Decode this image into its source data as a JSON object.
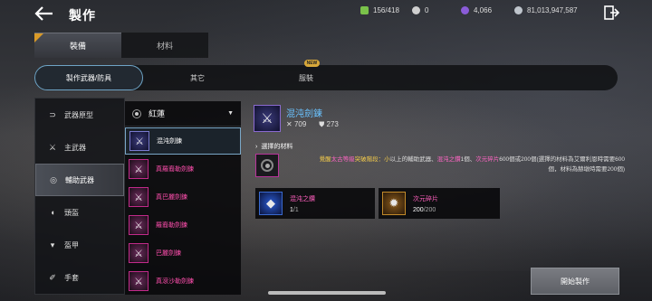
{
  "header": {
    "title": "製作",
    "currencies": [
      {
        "name": "inventory",
        "value": "156/418",
        "color": "#7ac24a"
      },
      {
        "name": "silver",
        "value": "0",
        "color": "#cfcfcf"
      },
      {
        "name": "crystal",
        "value": "4,066",
        "color": "#8a5cd8"
      },
      {
        "name": "gold",
        "value": "81,013,947,587",
        "color": "#bfc5cc"
      }
    ]
  },
  "main_tabs": [
    {
      "label": "裝備"
    },
    {
      "label": "材料"
    }
  ],
  "sub_tabs": [
    {
      "label": "製作武器/防具"
    },
    {
      "label": "其它"
    },
    {
      "label": "服裝",
      "badge": "NEW"
    }
  ],
  "categories": [
    {
      "label": "武器原型",
      "icon": "return-icon"
    },
    {
      "label": "主武器",
      "icon": "crossed-swords-icon"
    },
    {
      "label": "輔助武器",
      "icon": "ring-icon"
    },
    {
      "label": "頭盔",
      "icon": "helmet-icon"
    },
    {
      "label": "盔甲",
      "icon": "armor-icon"
    },
    {
      "label": "手套",
      "icon": "glove-icon"
    }
  ],
  "dropdown": {
    "value": "紅蓮"
  },
  "items": [
    {
      "name": "混沌劍鍊"
    },
    {
      "name": "真羅裔勒劍鍊"
    },
    {
      "name": "真巴麗劍鍊"
    },
    {
      "name": "羅裔勒劍鍊"
    },
    {
      "name": "巴麗劍鍊"
    },
    {
      "name": "真滾沙勒劍鍊"
    }
  ],
  "detail": {
    "name": "混沌劍鍊",
    "attack": "709",
    "defense": "273",
    "selected_label": "選擇的材料",
    "desc": {
      "p1": "覺醒",
      "p2": "太古等級",
      "p3": "突破階段：小",
      "p4": "以上的輔助武器、",
      "p5": "混沌之鑽",
      "p6": "1個、",
      "p7": "次元碎片",
      "p8": "600個或200個(選擇的材料為艾爾利恩時需要600個，材料為赫墩時需要200個)"
    }
  },
  "materials": [
    {
      "name": "混沌之鑽",
      "have": "1",
      "need": "/1"
    },
    {
      "name": "次元碎片",
      "have": "200",
      "need": "/200"
    }
  ],
  "craft_button": "開始製作"
}
